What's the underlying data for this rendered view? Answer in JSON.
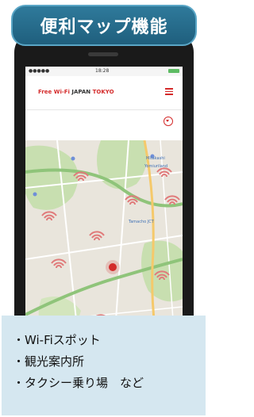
{
  "title": "便利マップ機能",
  "status_bar": {
    "carrier": "●●●●●",
    "time": "18:28"
  },
  "app_header": {
    "logo_red": "Free Wi-Fi",
    "logo_text": "JAPAN",
    "logo_tokyo": "TOKYO"
  },
  "map": {
    "labels": [
      "Mitakashi",
      "Yomiuriland",
      "Tamacho JCT"
    ]
  },
  "caption": {
    "items": [
      "・Wi-Fiスポット",
      "・観光案内所",
      "・タクシー乗り場　など"
    ]
  },
  "colors": {
    "banner": "#2f7a9b",
    "accent_red": "#d42b2b",
    "caption_bg": "#d5e7f0",
    "map_bg": "#e9e5dc",
    "park_green": "#c8dfb0",
    "road_green": "#8fc47a"
  },
  "icons": [
    "wifi-marker-icon",
    "menu-icon",
    "filter-icon",
    "location-pin-icon"
  ]
}
